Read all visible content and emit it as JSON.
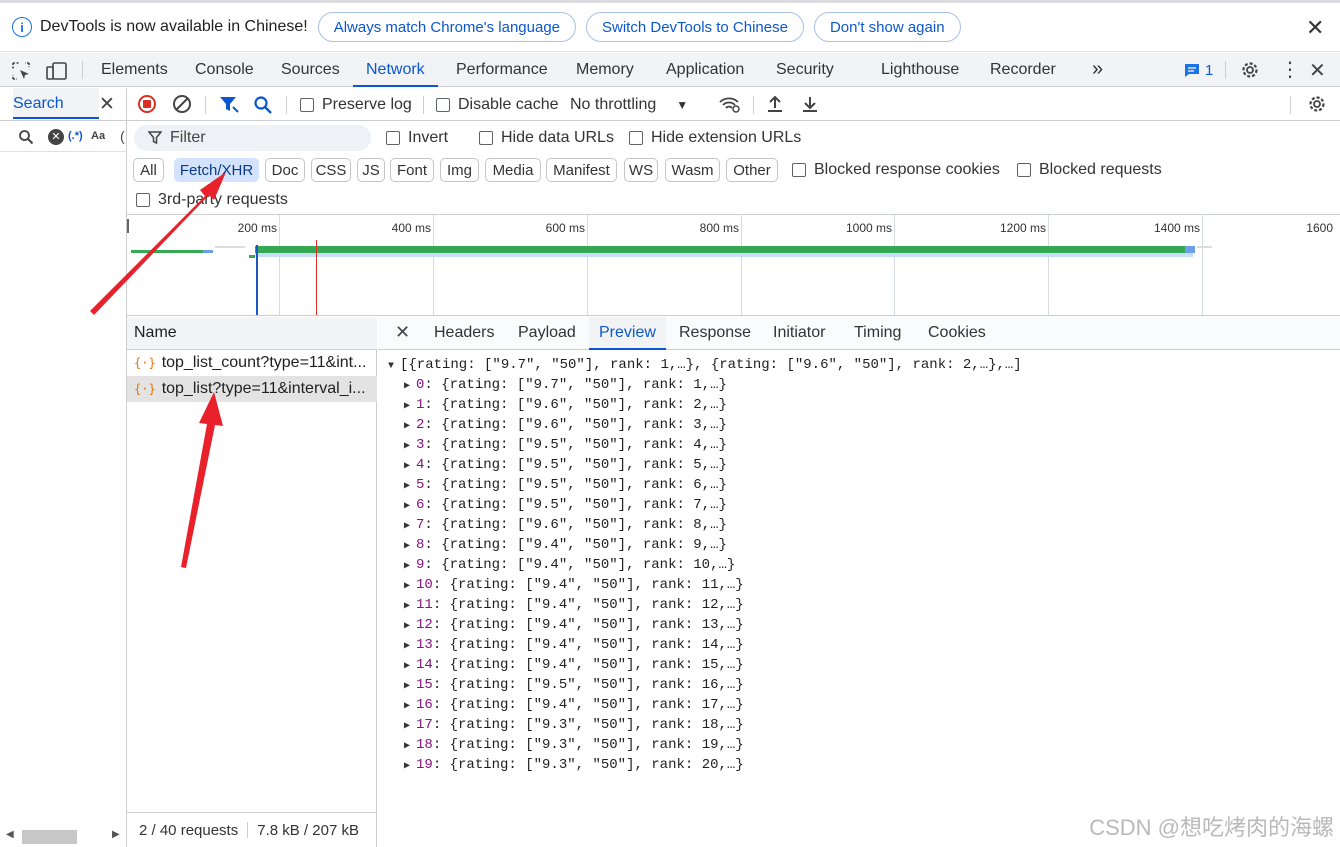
{
  "infobar": {
    "message": "DevTools is now available in Chinese!",
    "btn_match": "Always match Chrome's language",
    "btn_switch": "Switch DevTools to Chinese",
    "btn_dismiss": "Don't show again"
  },
  "tabs": [
    "Elements",
    "Console",
    "Sources",
    "Network",
    "Performance",
    "Memory",
    "Application",
    "Security",
    "Lighthouse",
    "Recorder"
  ],
  "active_tab": "Network",
  "issues_count": "1",
  "search_panel": {
    "tab_label": "Search",
    "regex_label": "(.*)",
    "case_label": "Aa"
  },
  "toolbar": {
    "preserve_log": "Preserve log",
    "disable_cache": "Disable cache",
    "throttling": "No throttling"
  },
  "filter": {
    "placeholder": "Filter",
    "invert": "Invert",
    "hide_data_urls": "Hide data URLs",
    "hide_extension_urls": "Hide extension URLs"
  },
  "types": [
    "All",
    "Fetch/XHR",
    "Doc",
    "CSS",
    "JS",
    "Font",
    "Img",
    "Media",
    "Manifest",
    "WS",
    "Wasm",
    "Other"
  ],
  "selected_type": "Fetch/XHR",
  "blocked_response_cookies": "Blocked response cookies",
  "blocked_requests": "Blocked requests",
  "third_party": "3rd-party requests",
  "timeline_ticks": [
    "200 ms",
    "400 ms",
    "600 ms",
    "800 ms",
    "1000 ms",
    "1200 ms",
    "1400 ms",
    "1600"
  ],
  "requests": {
    "header": "Name",
    "items": [
      "top_list_count?type=11&int...",
      "top_list?type=11&interval_i..."
    ],
    "status": "2 / 40 requests",
    "size": "7.8 kB / 207 kB"
  },
  "detail_tabs": [
    "Headers",
    "Payload",
    "Preview",
    "Response",
    "Initiator",
    "Timing",
    "Cookies"
  ],
  "active_detail_tab": "Preview",
  "preview": {
    "summary": "[{rating: [\"9.7\", \"50\"], rank: 1,…}, {rating: [\"9.6\", \"50\"], rank: 2,…},…]",
    "items": [
      {
        "index": "0",
        "rating": "9.7",
        "rank": "1"
      },
      {
        "index": "1",
        "rating": "9.6",
        "rank": "2"
      },
      {
        "index": "2",
        "rating": "9.6",
        "rank": "3"
      },
      {
        "index": "3",
        "rating": "9.5",
        "rank": "4"
      },
      {
        "index": "4",
        "rating": "9.5",
        "rank": "5"
      },
      {
        "index": "5",
        "rating": "9.5",
        "rank": "6"
      },
      {
        "index": "6",
        "rating": "9.5",
        "rank": "7"
      },
      {
        "index": "7",
        "rating": "9.6",
        "rank": "8"
      },
      {
        "index": "8",
        "rating": "9.4",
        "rank": "9"
      },
      {
        "index": "9",
        "rating": "9.4",
        "rank": "10"
      },
      {
        "index": "10",
        "rating": "9.4",
        "rank": "11"
      },
      {
        "index": "11",
        "rating": "9.4",
        "rank": "12"
      },
      {
        "index": "12",
        "rating": "9.4",
        "rank": "13"
      },
      {
        "index": "13",
        "rating": "9.4",
        "rank": "14"
      },
      {
        "index": "14",
        "rating": "9.4",
        "rank": "15"
      },
      {
        "index": "15",
        "rating": "9.5",
        "rank": "16"
      },
      {
        "index": "16",
        "rating": "9.4",
        "rank": "17"
      },
      {
        "index": "17",
        "rating": "9.3",
        "rank": "18"
      },
      {
        "index": "18",
        "rating": "9.3",
        "rank": "19"
      },
      {
        "index": "19",
        "rating": "9.3",
        "rank": "20"
      }
    ],
    "count_label": "50"
  },
  "watermark": "CSDN @想吃烤肉的海螺",
  "colors": {
    "accent": "#0b57d0",
    "record_red": "#d93025",
    "timeline_green": "#34a853",
    "arrow_red": "#e8212b"
  }
}
